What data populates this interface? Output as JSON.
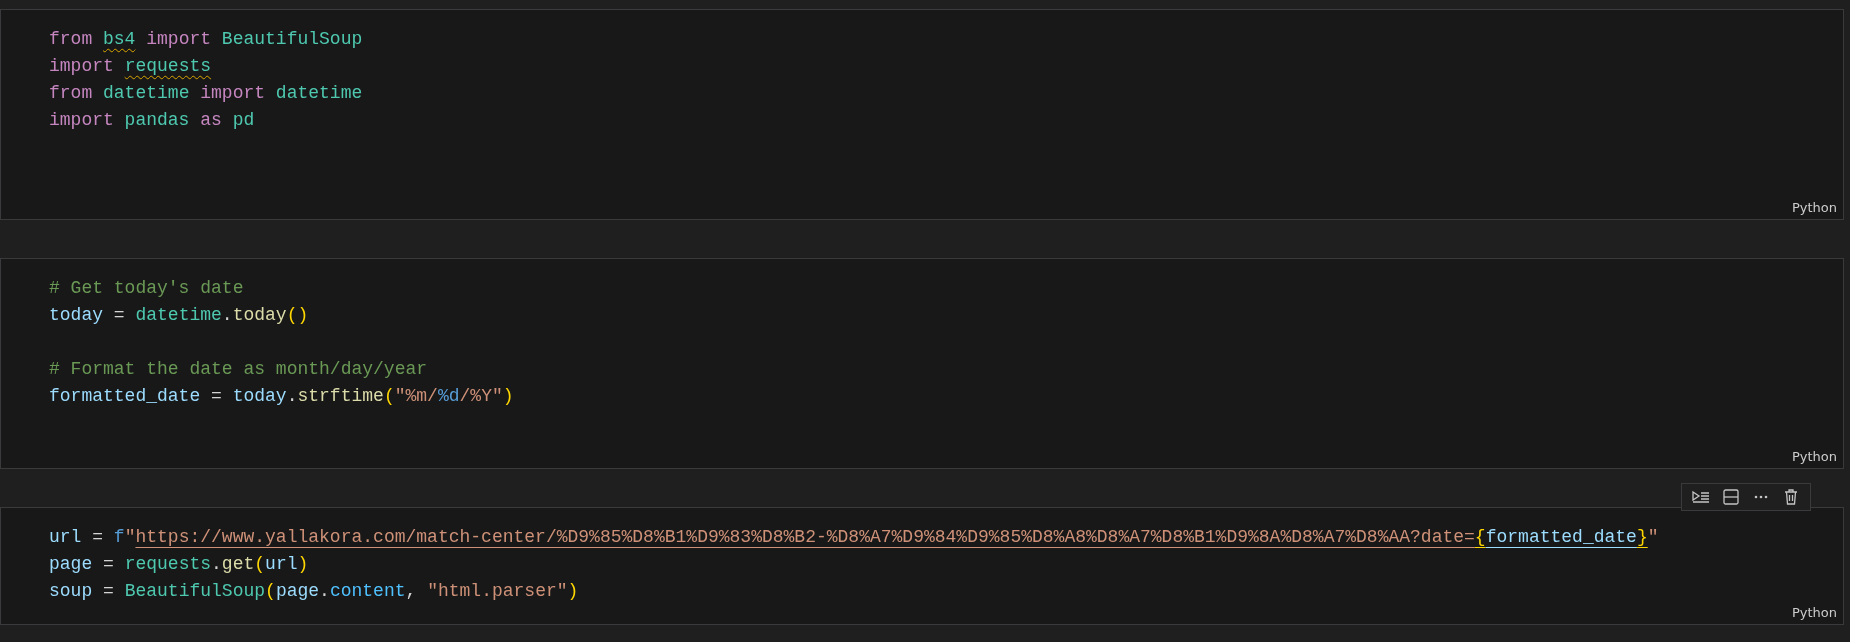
{
  "cells": [
    {
      "focused": false,
      "language": "Python",
      "lines": [
        {
          "kind": "code",
          "tokens": [
            {
              "t": "from ",
              "kind": "kw"
            },
            {
              "t": "bs4",
              "kind": "mod",
              "warning": true
            },
            {
              "t": " import",
              "kind": "kw"
            },
            {
              "t": " BeautifulSoup",
              "kind": "mod"
            }
          ]
        },
        {
          "kind": "code",
          "tokens": [
            {
              "t": "import ",
              "kind": "kw"
            },
            {
              "t": "requests",
              "kind": "mod",
              "warning": true
            }
          ]
        },
        {
          "kind": "code",
          "tokens": [
            {
              "t": "from",
              "kind": "kw"
            },
            {
              "t": " datetime ",
              "kind": "mod"
            },
            {
              "t": "import",
              "kind": "kw"
            },
            {
              "t": " datetime",
              "kind": "mod"
            }
          ]
        },
        {
          "kind": "code",
          "tokens": [
            {
              "t": "import",
              "kind": "kw"
            },
            {
              "t": " pandas ",
              "kind": "mod"
            },
            {
              "t": "as",
              "kind": "kw"
            },
            {
              "t": " pd",
              "kind": "mod"
            }
          ]
        }
      ]
    },
    {
      "focused": false,
      "language": "Python",
      "lines": [
        {
          "kind": "code",
          "tokens": [
            {
              "t": "# Get today's date",
              "kind": "cmt"
            }
          ]
        },
        {
          "kind": "code",
          "tokens": [
            {
              "t": "today",
              "kind": "var"
            },
            {
              "t": " = ",
              "kind": "plain"
            },
            {
              "t": "datetime",
              "kind": "mod"
            },
            {
              "t": ".",
              "kind": "plain"
            },
            {
              "t": "today",
              "kind": "fn"
            },
            {
              "t": "()",
              "kind": "bracket"
            }
          ]
        },
        {
          "kind": "blank"
        },
        {
          "kind": "code",
          "tokens": [
            {
              "t": "# Format the date as month/day/year",
              "kind": "cmt"
            }
          ]
        },
        {
          "kind": "code",
          "tokens": [
            {
              "t": "formatted_date",
              "kind": "var"
            },
            {
              "t": " = ",
              "kind": "plain"
            },
            {
              "t": "today",
              "kind": "var"
            },
            {
              "t": ".",
              "kind": "plain"
            },
            {
              "t": "strftime",
              "kind": "fn"
            },
            {
              "t": "(",
              "kind": "bracket"
            },
            {
              "t": "\"%m/",
              "kind": "str"
            },
            {
              "t": "%d",
              "kind": "esc"
            },
            {
              "t": "/%Y\"",
              "kind": "str"
            },
            {
              "t": ")",
              "kind": "bracket"
            }
          ]
        }
      ]
    },
    {
      "focused": true,
      "language": "Python",
      "lines": [
        {
          "kind": "code",
          "tokens": [
            {
              "t": "url",
              "kind": "var"
            },
            {
              "t": " = ",
              "kind": "plain"
            },
            {
              "t": "f",
              "kind": "esc"
            },
            {
              "t": "\"",
              "kind": "str"
            },
            {
              "t": "https://www.yallakora.com/match-center/%D9%85%D8%B1%D9%83%D8%B2-%D8%A7%D9%84%D9%85%D8%A8%D8%A7%D8%B1%D9%8A%D8%A7%D8%AA?date=",
              "kind": "str",
              "underline": true
            },
            {
              "t": "{",
              "kind": "bracket",
              "underline": true
            },
            {
              "t": "formatted_date",
              "kind": "var",
              "underline": true
            },
            {
              "t": "}",
              "kind": "bracket",
              "underline": true
            },
            {
              "t": "\"",
              "kind": "str"
            }
          ]
        },
        {
          "kind": "code",
          "tokens": [
            {
              "t": "page",
              "kind": "var"
            },
            {
              "t": " = ",
              "kind": "plain"
            },
            {
              "t": "requests",
              "kind": "mod"
            },
            {
              "t": ".",
              "kind": "plain"
            },
            {
              "t": "get",
              "kind": "fn"
            },
            {
              "t": "(",
              "kind": "bracket"
            },
            {
              "t": "url",
              "kind": "var"
            },
            {
              "t": ")",
              "kind": "bracket"
            }
          ]
        },
        {
          "kind": "code",
          "tokens": [
            {
              "t": "soup",
              "kind": "var"
            },
            {
              "t": " = ",
              "kind": "plain"
            },
            {
              "t": "BeautifulSoup",
              "kind": "mod"
            },
            {
              "t": "(",
              "kind": "bracket"
            },
            {
              "t": "page",
              "kind": "var"
            },
            {
              "t": ".",
              "kind": "plain"
            },
            {
              "t": "content",
              "kind": "prop"
            },
            {
              "t": ", ",
              "kind": "plain"
            },
            {
              "t": "\"html.parser\"",
              "kind": "str"
            },
            {
              "t": ")",
              "kind": "bracket"
            }
          ]
        }
      ]
    }
  ]
}
